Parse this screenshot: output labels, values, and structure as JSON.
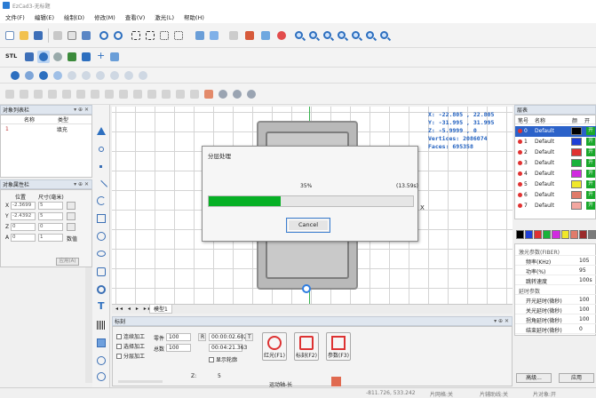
{
  "window": {
    "title": "EzCad3-无标题"
  },
  "menu": [
    "文件(F)",
    "编辑(E)",
    "绘制(D)",
    "修改(M)",
    "查看(V)",
    "激光(L)",
    "帮助(H)"
  ],
  "toolbar_icons": {
    "row1": [
      "new-icon",
      "open-icon",
      "save-icon",
      "print-icon",
      "cut-icon",
      "copy-icon",
      "paste-icon",
      "undo-icon",
      "redo-icon",
      "node-icon",
      "dash-icon",
      "array-icon",
      "group-icon",
      "ungroup-icon",
      "lock-icon",
      "tools-icon",
      "scanner-icon",
      "zoom-in-icon",
      "zoom-out-icon",
      "zoom-window-icon",
      "zoom-all-icon",
      "zoom-selected-icon",
      "zoom-fit-icon"
    ],
    "row2": [
      "stl-icon",
      "3d-model-icon",
      "3d-view-icon",
      "sphere-icon",
      "stack-icon",
      "cut-plane-icon",
      "cross-icon",
      "pen-icon"
    ]
  },
  "stl_label": "STL",
  "object_list": {
    "title": "对象列表栏",
    "columns": [
      "名称",
      "类型"
    ],
    "rows": [
      {
        "id": "1",
        "name": "",
        "type": "填充"
      }
    ]
  },
  "properties": {
    "title": "对象属性栏",
    "headers": [
      "位置",
      "尺寸(毫米)"
    ],
    "rows": [
      {
        "axis": "X",
        "pos": "-2.3699",
        "size": "5"
      },
      {
        "axis": "Y",
        "pos": "-2.4392",
        "size": "5"
      },
      {
        "axis": "Z",
        "pos": "0",
        "size": "0"
      },
      {
        "axis": "A",
        "pos": "0",
        "size": "1",
        "extra": "数值"
      }
    ],
    "apply_label": "应用(A)"
  },
  "coordinates": {
    "x": "X: -22.805 , 22.805",
    "y": "Y: -31.995 , 31.995",
    "z": "Z: -5.9999 , 0",
    "vertices": "Vertices: 2086074",
    "faces": "Faces: 695358"
  },
  "canvas_tab": "模型1",
  "dialog": {
    "title": "分层处理",
    "progress_label": "35%",
    "progress": 0.35,
    "time": "(13.59s)",
    "cancel_label": "Cancel"
  },
  "processing": {
    "title": "标刻",
    "checkboxes": [
      "连续加工",
      "选择加工",
      "分层加工"
    ],
    "part_label": "零件",
    "part_value": "100",
    "total_label": "总数",
    "total_value": "100",
    "r_label": "R",
    "time1": "00:00:02.602",
    "time2": "00:04:21.363",
    "show_outline": "显示轮廓",
    "buttons": [
      {
        "icon": "red-light-icon",
        "label": "红光(F1)"
      },
      {
        "icon": "mark-icon",
        "label": "标刻(F2)"
      },
      {
        "icon": "params-icon",
        "label": "参数(F3)"
      }
    ],
    "z_label": "Z:",
    "z_value": "5",
    "move_label": "运动轴-长"
  },
  "layers": {
    "title": "层表",
    "columns": [
      "笔号",
      "名称",
      "颜",
      "开"
    ],
    "rows": [
      {
        "num": "0",
        "name": "Default",
        "color": "#000000",
        "on": "开"
      },
      {
        "num": "1",
        "name": "Default",
        "color": "#1f3fd6",
        "on": "开"
      },
      {
        "num": "2",
        "name": "Default",
        "color": "#e03131",
        "on": "开"
      },
      {
        "num": "3",
        "name": "Default",
        "color": "#18b33a",
        "on": "开"
      },
      {
        "num": "4",
        "name": "Default",
        "color": "#d12ae0",
        "on": "开"
      },
      {
        "num": "5",
        "name": "Default",
        "color": "#f0e82a",
        "on": "开"
      },
      {
        "num": "6",
        "name": "Default",
        "color": "#e07b6a",
        "on": "开"
      },
      {
        "num": "7",
        "name": "Default",
        "color": "#f3a7a0",
        "on": "开"
      }
    ],
    "palette": [
      "#000000",
      "#1f3fd6",
      "#e03131",
      "#18b33a",
      "#d12ae0",
      "#f0e82a",
      "#e07b6a",
      "#9a2b2b",
      "#7a7a7a"
    ]
  },
  "laser_params": [
    {
      "group": true,
      "key": "激光参数(FIBER)"
    },
    {
      "key": "频率(KHz)",
      "value": "105"
    },
    {
      "key": "功率(%)",
      "value": "95"
    },
    {
      "key": "跳转速度",
      "value": "100s"
    },
    {
      "group": true,
      "key": "延时参数"
    },
    {
      "key": "开光延时(微秒)",
      "value": "100"
    },
    {
      "key": "关光延时(微秒)",
      "value": "100"
    },
    {
      "key": "拐角延时(微秒)",
      "value": "100"
    },
    {
      "key": "结束延时(微秒)",
      "value": "0"
    }
  ],
  "layer_buttons": [
    "高级...",
    "应用"
  ],
  "status": {
    "coords": "-811.726, 533.242",
    "grid": "片网格:关",
    "guide": "片辅助线:关",
    "snap": "片对象:开"
  }
}
